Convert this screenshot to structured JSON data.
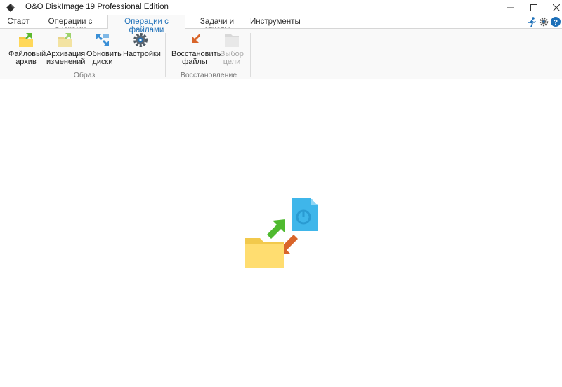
{
  "window": {
    "title": "O&O DiskImage 19 Professional Edition",
    "app_icon": "diamond-app-icon",
    "controls": {
      "minimize": "—",
      "maximize": "☐",
      "close": "✕"
    }
  },
  "tabs": [
    {
      "label": "Старт",
      "active": false
    },
    {
      "label": "Операции с дисками",
      "active": false
    },
    {
      "label": "Операции с файлами",
      "active": true
    },
    {
      "label": "Задачи и отчеты",
      "active": false
    },
    {
      "label": "Инструменты",
      "active": false
    }
  ],
  "quick_icons": [
    "run-icon",
    "gear-icon",
    "help-icon"
  ],
  "ribbon": {
    "groups": [
      {
        "label": "Образ",
        "buttons": [
          {
            "line1": "Файловый",
            "line2": "архив",
            "icon": "file-archive-icon",
            "enabled": true
          },
          {
            "line1": "Архивация",
            "line2": "изменений",
            "icon": "incremental-archive-icon",
            "enabled": true
          },
          {
            "line1": "Обновить",
            "line2": "диски",
            "icon": "refresh-disks-icon",
            "enabled": true
          },
          {
            "line1": "Настройки",
            "line2": "",
            "icon": "settings-gear-icon",
            "enabled": true
          }
        ]
      },
      {
        "label": "Восстановление",
        "buttons": [
          {
            "line1": "Восстановить",
            "line2": "файлы",
            "icon": "restore-files-icon",
            "enabled": true
          },
          {
            "line1": "Выбор",
            "line2": "цели",
            "icon": "select-target-icon",
            "enabled": false
          }
        ]
      }
    ]
  },
  "main": {
    "hero_icon": "file-operations-illustration-icon"
  },
  "colors": {
    "accent": "#1c6fb8",
    "ribbon_bg": "#f9f9f9",
    "border": "#d6d6d6",
    "disabled_text": "#a8a8a8"
  }
}
